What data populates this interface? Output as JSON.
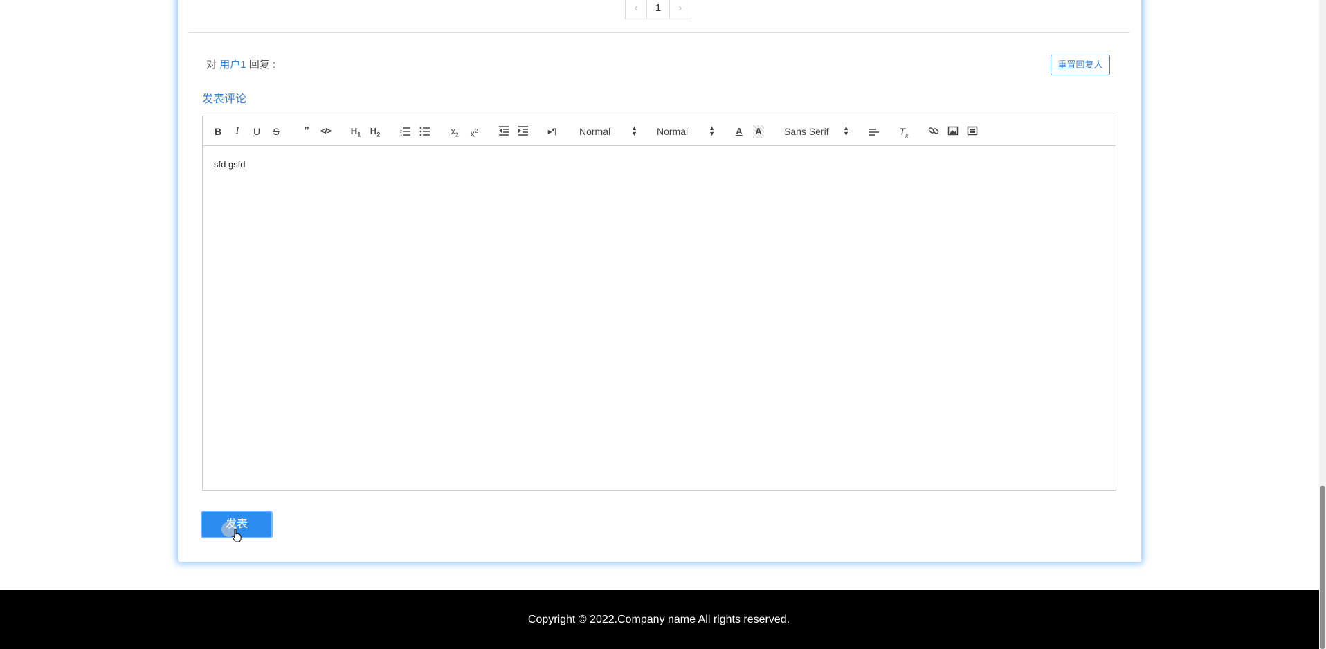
{
  "pagination": {
    "prev": "‹",
    "page": "1",
    "next": "›"
  },
  "reply": {
    "prefix": "对",
    "user": "用户1",
    "suffix": "回复 :",
    "reset_button": "重置回复人"
  },
  "comment": {
    "title": "发表评论",
    "content": "sfd gsfd",
    "submit_button": "发表"
  },
  "toolbar": {
    "header_select": "Normal",
    "size_select": "Normal",
    "font_select": "Sans Serif",
    "buttons": [
      "bold-icon",
      "italic-icon",
      "underline-icon",
      "strike-icon",
      "blockquote-icon",
      "code-block-icon",
      "h1-icon",
      "h2-icon",
      "ordered-list-icon",
      "bullet-list-icon",
      "subscript-icon",
      "superscript-icon",
      "outdent-icon",
      "indent-icon",
      "rtl-icon",
      "text-color-icon",
      "background-color-icon",
      "align-icon",
      "clear-format-icon",
      "link-icon",
      "image-icon",
      "video-icon"
    ]
  },
  "footer": {
    "copyright": "Copyright © 2022.Company name All rights reserved."
  },
  "colors": {
    "accent": "#2d8cf0",
    "link": "#3a7fd0",
    "footer_bg": "#000000"
  }
}
